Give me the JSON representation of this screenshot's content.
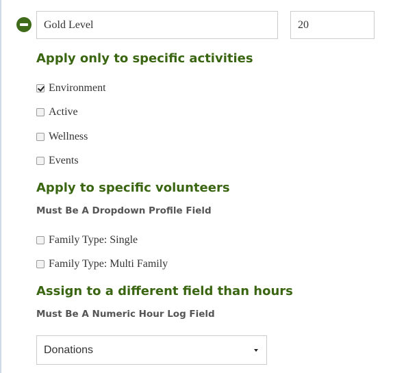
{
  "level": {
    "name_value": "Gold Level",
    "points_value": "20"
  },
  "activities": {
    "heading": "Apply only to specific activities",
    "items": [
      {
        "label": "Environment",
        "checked": true
      },
      {
        "label": "Active",
        "checked": false
      },
      {
        "label": "Wellness",
        "checked": false
      },
      {
        "label": "Events",
        "checked": false
      }
    ]
  },
  "volunteers": {
    "heading": "Apply to specific volunteers",
    "sublabel": "Must Be A Dropdown Profile Field",
    "items": [
      {
        "label": "Family Type: Single",
        "checked": false
      },
      {
        "label": "Family Type: Multi Family",
        "checked": false
      }
    ]
  },
  "assign": {
    "heading": "Assign to a different field than hours",
    "sublabel": "Must Be A Numeric Hour Log Field",
    "selected": "Donations"
  },
  "colors": {
    "accent": "#3a6612",
    "remove_button": "#3f6b1a"
  },
  "icons": {
    "remove": "minus-circle-icon",
    "dropdown": "caret-down-icon"
  }
}
